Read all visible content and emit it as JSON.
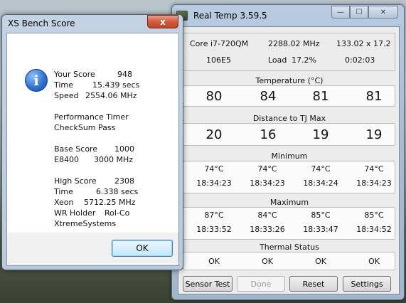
{
  "realtemp": {
    "title": "Real Temp 3.59.5",
    "caption": {
      "minimize": "—",
      "maximize": "☐",
      "close": "✕"
    },
    "info": {
      "cpu": "Core i7-720QM",
      "mhz": "2288.02 MHz",
      "multiplier": "133.02 x 17.2",
      "cpuid": "106E5",
      "load_label": "Load",
      "load_value": "17.2%",
      "time": "0:02:03"
    },
    "temperature": {
      "label": "Temperature (°C)",
      "values": [
        "80",
        "84",
        "81",
        "81"
      ]
    },
    "distance": {
      "label": "Distance to TJ Max",
      "values": [
        "20",
        "16",
        "19",
        "19"
      ]
    },
    "minimum": {
      "label": "Minimum",
      "temps": [
        "74°C",
        "74°C",
        "74°C",
        "74°C"
      ],
      "times": [
        "18:34:23",
        "18:34:23",
        "18:34:24",
        "18:34:23"
      ]
    },
    "maximum": {
      "label": "Maximum",
      "temps": [
        "87°C",
        "84°C",
        "85°C",
        "85°C"
      ],
      "times": [
        "18:33:52",
        "18:33:26",
        "18:33:47",
        "18:34:52"
      ]
    },
    "thermal": {
      "label": "Thermal Status",
      "values": [
        "OK",
        "OK",
        "OK",
        "OK"
      ]
    },
    "buttons": {
      "sensor_test": "Sensor Test",
      "done": "Done",
      "reset": "Reset",
      "settings": "Settings"
    }
  },
  "xsbench": {
    "title": "XS Bench Score",
    "close": "x",
    "icon": "i",
    "your_score_label": "Your Score",
    "your_score_value": "948",
    "time_label": "Time",
    "time_value": "15.439 secs",
    "speed_label": "Speed",
    "speed_value": "2554.06 MHz",
    "perf_timer": "Performance Timer",
    "checksum": "CheckSum Pass",
    "base_score_label": "Base Score",
    "base_score_value": "1000",
    "base_cpu": "E8400",
    "base_mhz": "3000 MHz",
    "high_score_label": "High Score",
    "high_score_value": "2308",
    "high_time_label": "Time",
    "high_time_value": "6.338 secs",
    "xeon_label": "Xeon",
    "xeon_mhz": "5712.25 MHz",
    "wr_label": "WR Holder",
    "wr_name": "Rol-Co",
    "xtreme": "XtremeSystems",
    "ok_label": "OK"
  },
  "colors": {
    "window_frame": "#b9cbe0",
    "dialog_accent": "#3c7fb1",
    "close_red": "#c2422a"
  },
  "icons": {
    "info": "information-icon",
    "app": "realtemp-app-icon"
  }
}
